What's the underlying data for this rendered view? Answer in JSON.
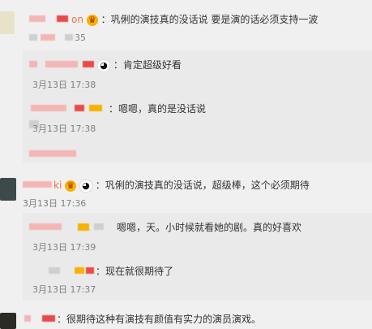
{
  "comments": [
    {
      "user_tail": "on",
      "text": "：巩俐的演技真的没话说 要是演的话必须支持一波",
      "count": "35",
      "replies": [
        {
          "text": "：肯定超级好看",
          "time": "3月13日 17:38"
        },
        {
          "text": "：嗯嗯，真的是没话说",
          "time": "3月13日 17:38"
        }
      ]
    },
    {
      "user_tail": "ki",
      "text": "：巩俐的演技真的没话说，超级棒，这个必须期待",
      "time": "3月13日 17:36",
      "replies": [
        {
          "text": "嗯嗯，天。小时候就看她的剧。真的好喜欢",
          "time": "3月13日 17:39"
        },
        {
          "text": "：现在就很期待了",
          "time": "3月13日 17:37"
        }
      ]
    },
    {
      "text": "：很期待这种有演技有颜值有实力的演员演戏。"
    }
  ],
  "icons": {
    "crown": "crown-emoji-icon",
    "panda": "panda-emoji-icon"
  }
}
